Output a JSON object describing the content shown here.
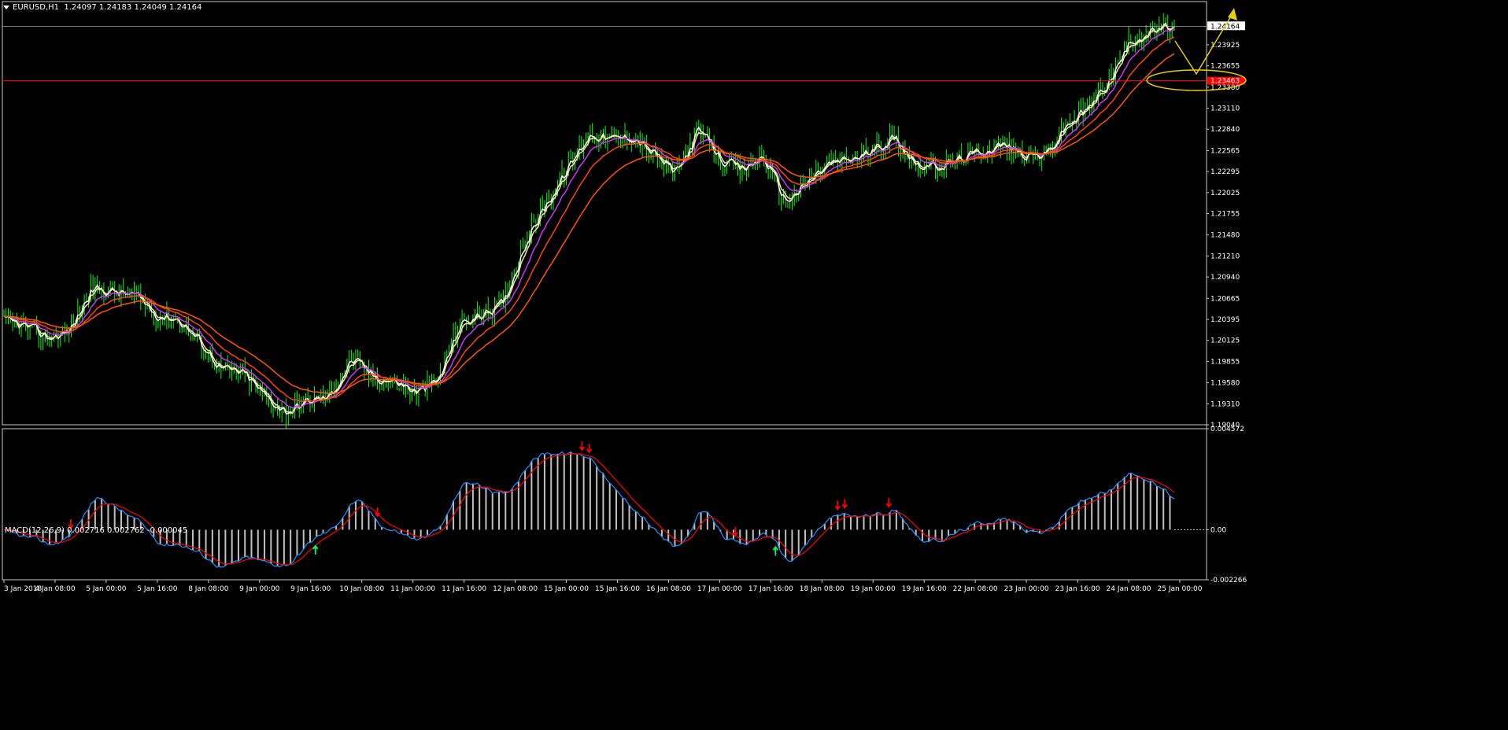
{
  "chart_data": [
    {
      "type": "line",
      "title": "EURUSD,H1",
      "ohlc": {
        "open": "1.24097",
        "high": "1.24183",
        "low": "1.24049",
        "close": "1.24164"
      },
      "current_price_label": "1.24164",
      "current_price": 1.24164,
      "horizontal_line_label": "1.23463",
      "horizontal_line_value": 1.23463,
      "ylim": [
        1.1904,
        1.2444
      ],
      "y_ticks": [
        "1.23925",
        "1.23655",
        "1.23380",
        "1.23110",
        "1.22840",
        "1.22565",
        "1.22295",
        "1.22025",
        "1.21755",
        "1.21480",
        "1.21210",
        "1.20940",
        "1.20665",
        "1.20395",
        "1.20125",
        "1.19855",
        "1.19580",
        "1.19310",
        "1.19040"
      ],
      "x_ticks": [
        "3 Jan 2018",
        "4 Jan 08:00",
        "5 Jan 00:00",
        "5 Jan 16:00",
        "8 Jan 08:00",
        "9 Jan 00:00",
        "9 Jan 16:00",
        "10 Jan 08:00",
        "11 Jan 00:00",
        "11 Jan 16:00",
        "12 Jan 08:00",
        "15 Jan 00:00",
        "15 Jan 16:00",
        "16 Jan 08:00",
        "17 Jan 00:00",
        "17 Jan 16:00",
        "18 Jan 08:00",
        "19 Jan 00:00",
        "19 Jan 16:00",
        "22 Jan 08:00",
        "23 Jan 00:00",
        "23 Jan 16:00",
        "24 Jan 08:00",
        "25 Jan 00:00"
      ],
      "price_path_keypoints": [
        1.2035,
        1.203,
        1.2015,
        1.2025,
        1.208,
        1.2075,
        1.207,
        1.2045,
        1.204,
        1.201,
        1.1975,
        1.197,
        1.194,
        1.192,
        1.1935,
        1.194,
        1.199,
        1.1965,
        1.196,
        1.1945,
        1.196,
        1.2035,
        1.2045,
        1.206,
        1.214,
        1.219,
        1.2235,
        1.228,
        1.227,
        1.2275,
        1.225,
        1.2225,
        1.2285,
        1.2245,
        1.223,
        1.225,
        1.219,
        1.2215,
        1.224,
        1.2245,
        1.2255,
        1.2275,
        1.224,
        1.2235,
        1.2245,
        1.2255,
        1.2265,
        1.225,
        1.225,
        1.229,
        1.231,
        1.235,
        1.24,
        1.241,
        1.2416
      ],
      "series": [
        {
          "color": "#ffffff",
          "period": 3
        },
        {
          "color": "#ffdead",
          "period": 5
        },
        {
          "color": "#cc33ff",
          "period": 12
        },
        {
          "color": "#ff4500",
          "period": 22
        },
        {
          "color": "#ff5500",
          "period": 40
        }
      ],
      "annotation": {
        "color": "#e8d000",
        "shapes": [
          "ellipse",
          "arrow-down",
          "arrow-up"
        ]
      }
    },
    {
      "type": "line",
      "title": "MACD(12,26,9) 0.002716 0.002762 -0.000045",
      "ylim": [
        -0.002266,
        0.004572
      ],
      "y_ticks": [
        "0.004572",
        "0.00",
        "-0.002266"
      ],
      "series_colors": {
        "macd": "#1e90ff",
        "signal": "#ff0000",
        "histogram": "#c0c0c0"
      },
      "signal_arrows": {
        "down": [
          "4 Jan 08:00",
          "10 Jan 08:00",
          "15 Jan 00:00",
          "15 Jan 00:00",
          "17 Jan 00:00",
          "18 Jan 08:00",
          "18 Jan 08:00",
          "19 Jan 00:00"
        ],
        "up": [
          "9 Jan 16:00",
          "17 Jan 16:00"
        ]
      }
    }
  ]
}
